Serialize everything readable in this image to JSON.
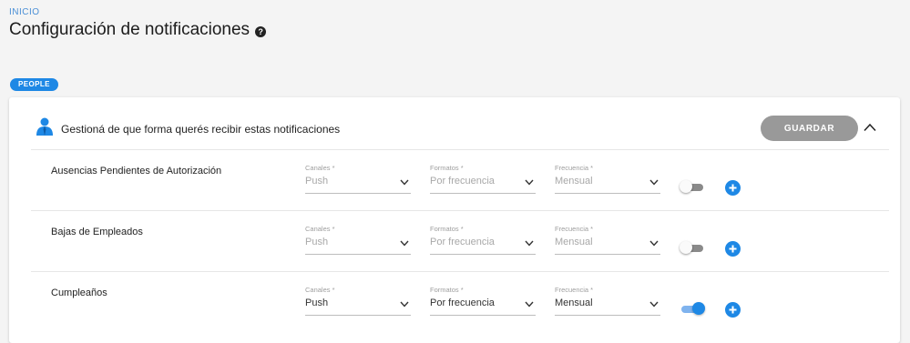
{
  "breadcrumb": "INICIO",
  "page_title": "Configuración de notificaciones",
  "help_icon_glyph": "?",
  "tag": "PEOPLE",
  "card": {
    "header_text": "Gestioná de que forma querés recibir estas notificaciones",
    "header_icon": "person-icon",
    "save_label": "GUARDAR",
    "collapse_icon": "chevron-up-icon"
  },
  "field_labels": {
    "canales": "Canales *",
    "formatos": "Formatos *",
    "frecuencia": "Frecuencia *"
  },
  "rows": [
    {
      "label": "Ausencias Pendientes de Autorización",
      "canal": "Push",
      "formato": "Por frecuencia",
      "frecuencia": "Mensual",
      "enabled": false
    },
    {
      "label": "Bajas de Empleados",
      "canal": "Push",
      "formato": "Por frecuencia",
      "frecuencia": "Mensual",
      "enabled": false
    },
    {
      "label": "Cumpleaños",
      "canal": "Push",
      "formato": "Por frecuencia",
      "frecuencia": "Mensual",
      "enabled": true
    }
  ],
  "colors": {
    "accent": "#1e88e5",
    "save_button": "#999999",
    "toggle_off": "#8a8a8a",
    "toggle_on_track": "#7fb3ee"
  }
}
